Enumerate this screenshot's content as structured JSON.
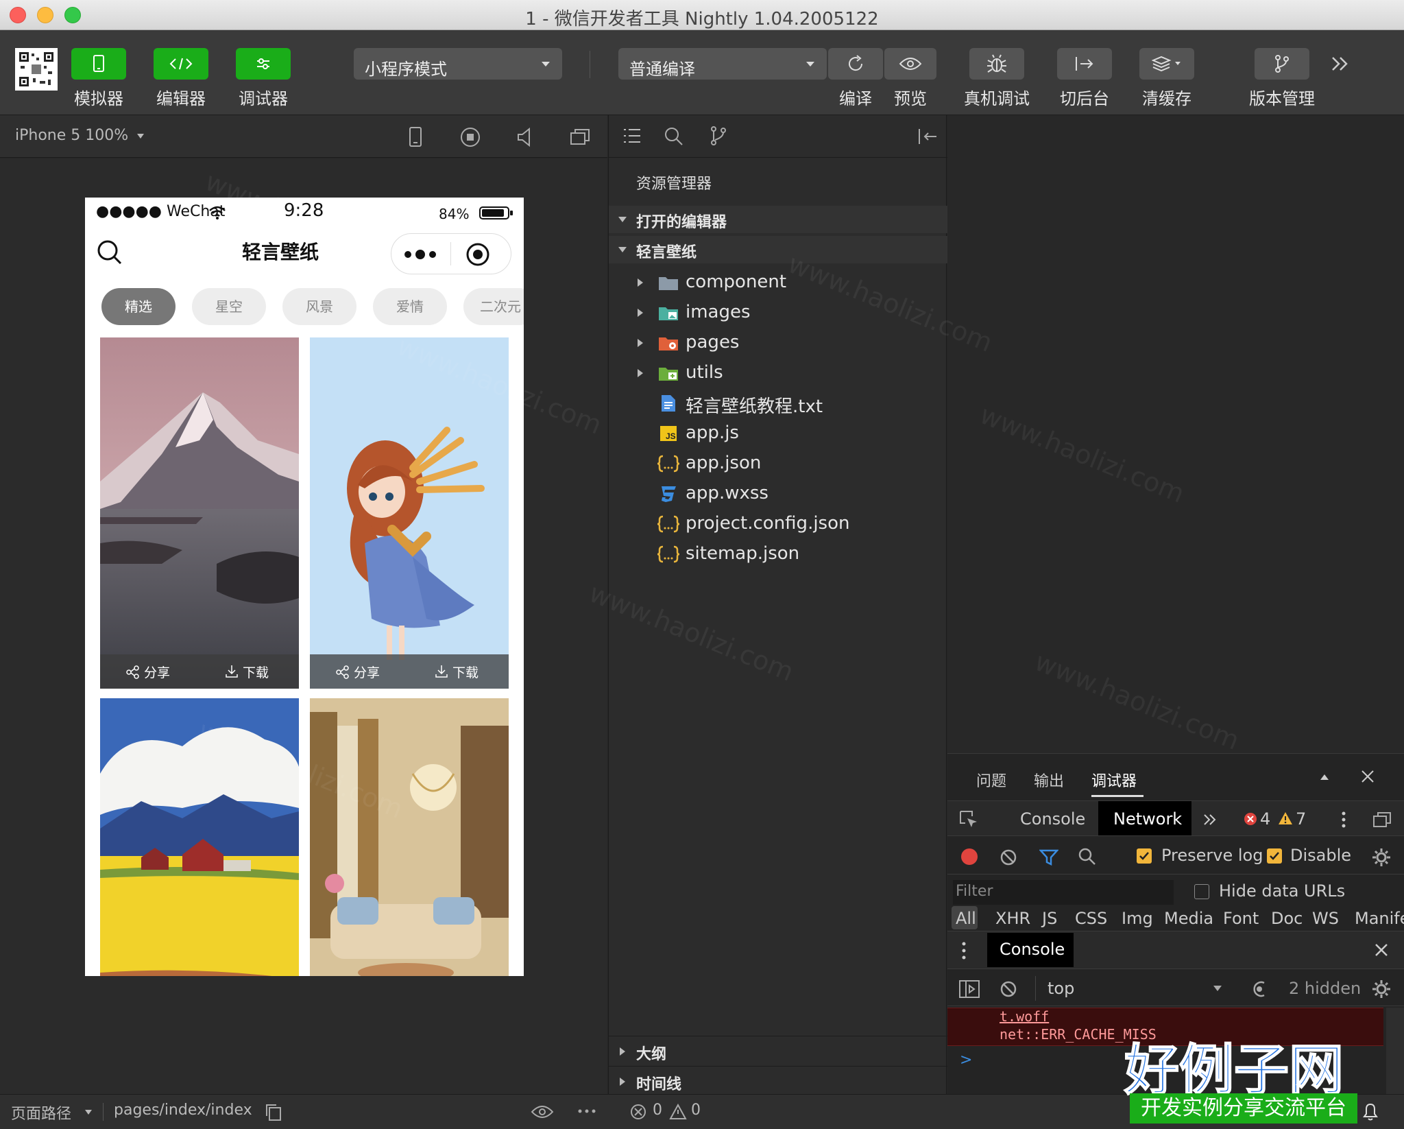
{
  "window": {
    "title": "1 - 微信开发者工具 Nightly 1.04.2005122"
  },
  "toolbar": {
    "simulator": "模拟器",
    "editor": "编辑器",
    "debugger": "调试器",
    "mode_select": "小程序模式",
    "compile_select": "普通编译",
    "compile": "编译",
    "preview": "预览",
    "remote_debug": "真机调试",
    "background": "切后台",
    "clear_cache": "清缓存",
    "version": "版本管理"
  },
  "simulator": {
    "device": "iPhone 5 100%",
    "status": {
      "carrier": "●●●●● WeChat",
      "time": "9:28",
      "battery": "84%"
    },
    "app_title": "轻言壁纸",
    "chips": [
      "精选",
      "星空",
      "风景",
      "爱情",
      "二次元"
    ],
    "share": "分享",
    "download": "下载"
  },
  "explorer": {
    "title": "资源管理器",
    "open_editors": "打开的编辑器",
    "project": "轻言壁纸",
    "files": [
      {
        "name": "component",
        "icon": "folder-icon"
      },
      {
        "name": "images",
        "icon": "image-folder-icon"
      },
      {
        "name": "pages",
        "icon": "pages-folder-icon"
      },
      {
        "name": "utils",
        "icon": "utils-folder-icon"
      },
      {
        "name": "轻言壁纸教程.txt",
        "icon": "text-file-icon"
      },
      {
        "name": "app.js",
        "icon": "js-file-icon"
      },
      {
        "name": "app.json",
        "icon": "json-file-icon"
      },
      {
        "name": "app.wxss",
        "icon": "css-file-icon"
      },
      {
        "name": "project.config.json",
        "icon": "json-file-icon"
      },
      {
        "name": "sitemap.json",
        "icon": "json-file-icon"
      }
    ],
    "outline": "大纲",
    "timeline": "时间线"
  },
  "devtools": {
    "tabs": [
      "问题",
      "输出",
      "调试器"
    ],
    "console_tab": "Console",
    "network_tab": "Network",
    "errors": "4",
    "warnings": "7",
    "preserve_log": "Preserve log",
    "disable_cache": "Disable",
    "filter_placeholder": "Filter",
    "hide_data_urls": "Hide data URLs",
    "types": [
      "All",
      "XHR",
      "JS",
      "CSS",
      "Img",
      "Media",
      "Font",
      "Doc",
      "WS",
      "Manife"
    ],
    "drawer_console": "Console",
    "context": "top",
    "hidden": "2 hidden",
    "log_line1": "t.woff",
    "log_line2": "net::ERR_CACHE_MISS",
    "prompt": ">"
  },
  "statusbar": {
    "path_label": "页面路径",
    "path": "pages/index/index",
    "errors": "0",
    "warnings": "0"
  },
  "watermark": {
    "text": "www.haolizi.com",
    "brand": "好例子网",
    "slogan": "开发实例分享交流平台"
  },
  "colors": {
    "accent_green": "#1aad19",
    "error_red": "#e0443e",
    "warning_yellow": "#f2b63b"
  }
}
